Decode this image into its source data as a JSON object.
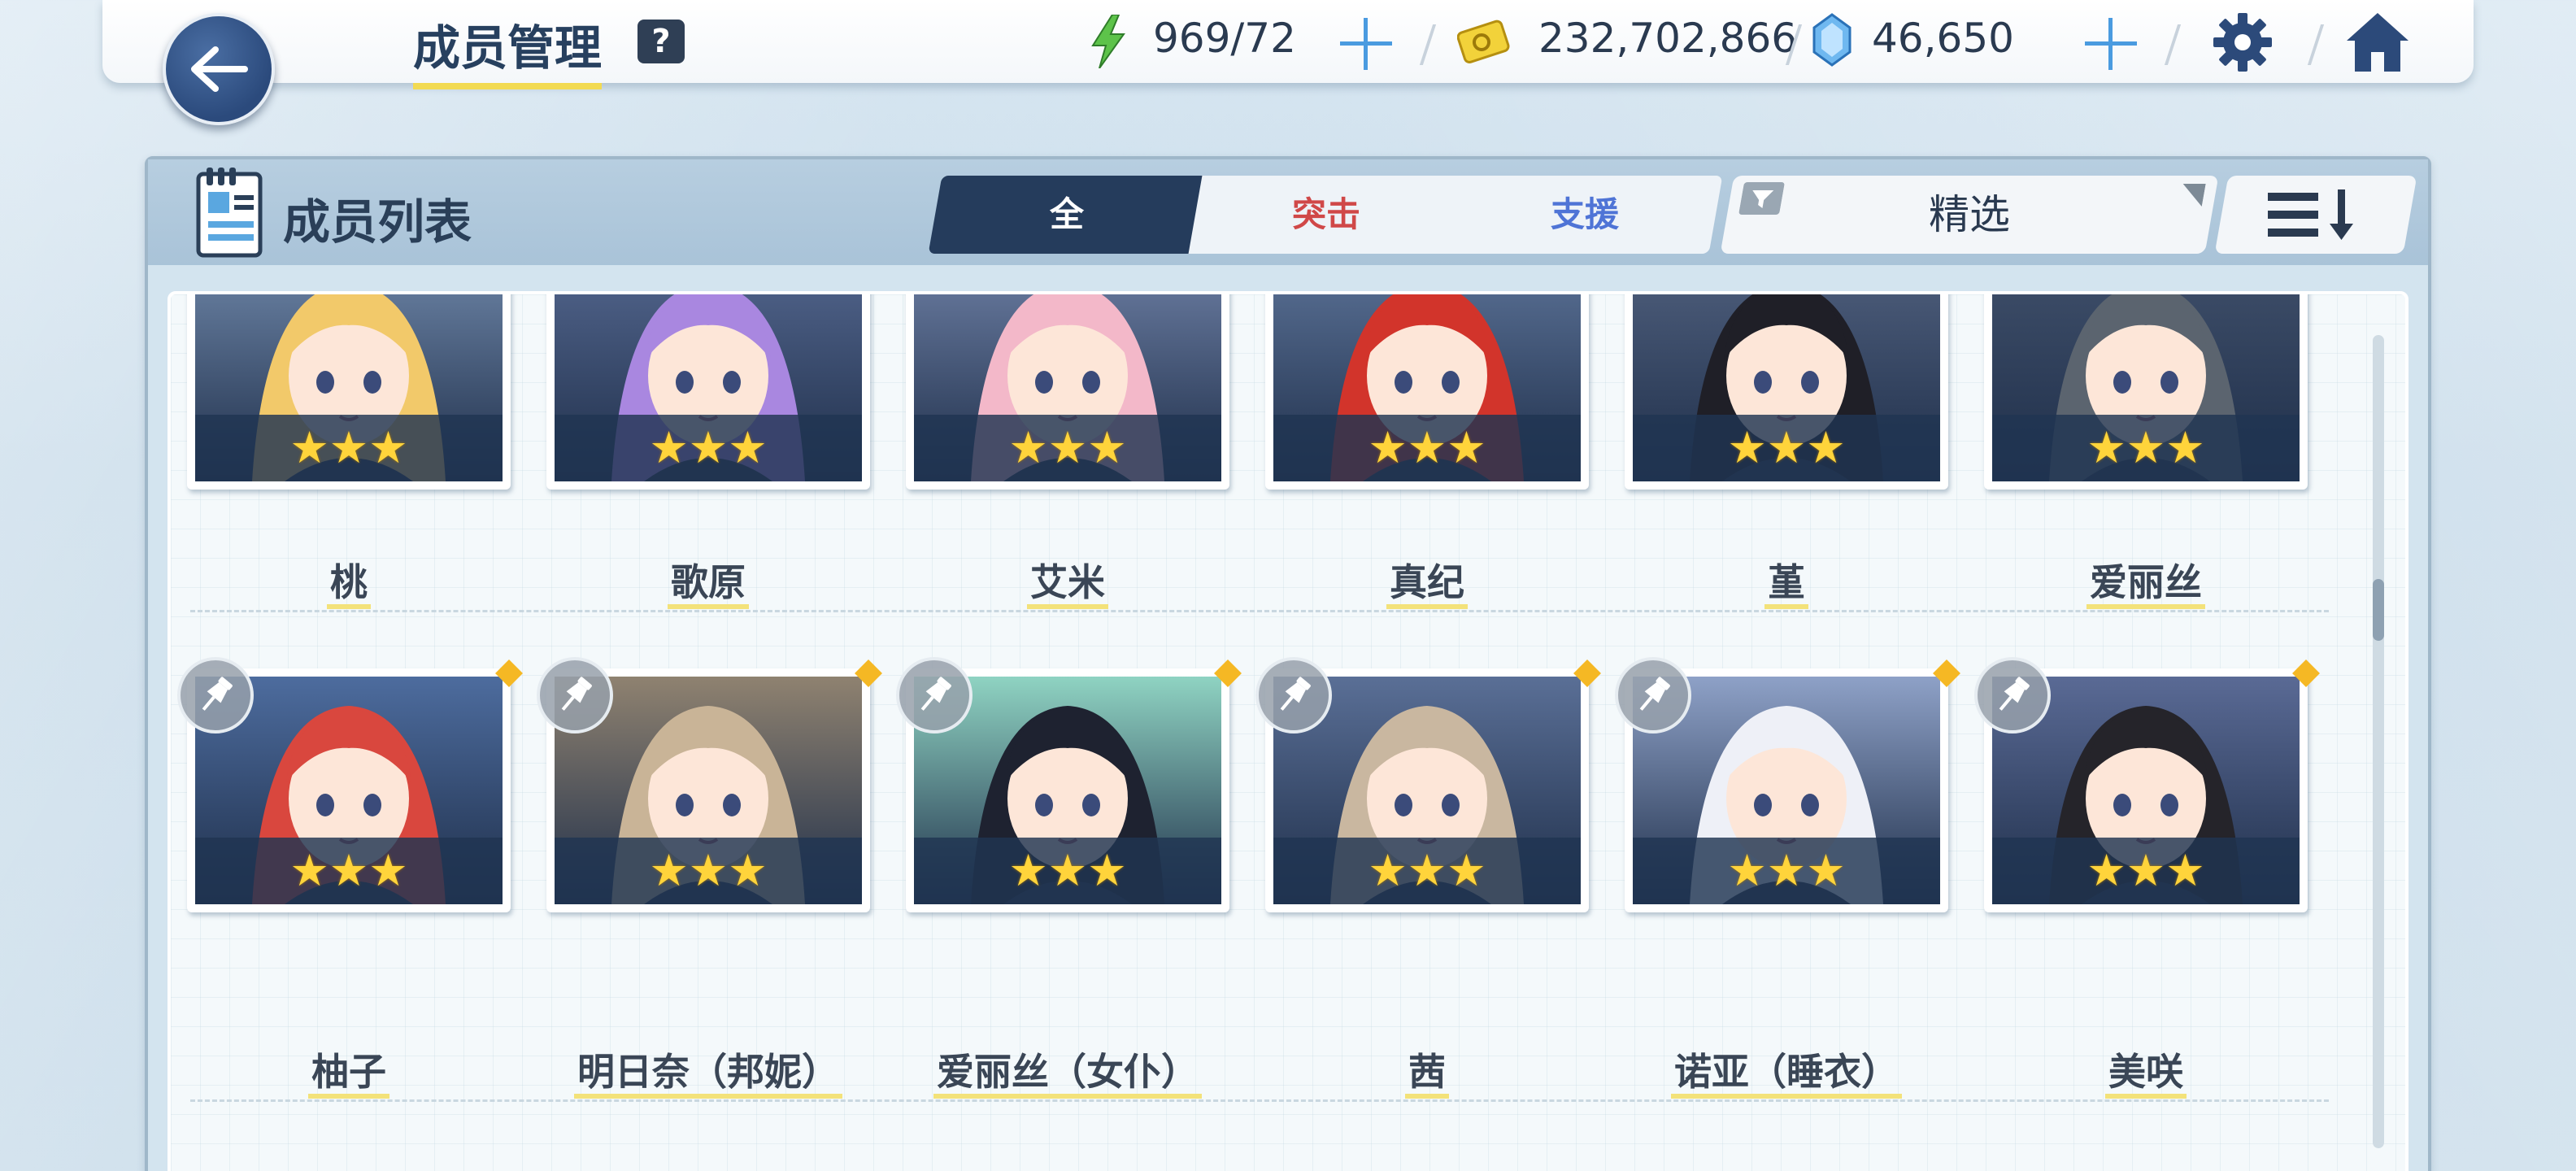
{
  "header": {
    "title": "成员管理",
    "help_label": "?",
    "ap_value": "969/72",
    "credits_value": "232,702,866",
    "pyroxene_value": "46,650"
  },
  "panel": {
    "title": "成员列表",
    "tabs": [
      {
        "label": "全",
        "active": true
      },
      {
        "label": "突击",
        "active": false
      },
      {
        "label": "支援",
        "active": false
      }
    ],
    "filter_label": "精选"
  },
  "characters": [
    {
      "name": "桃",
      "stars": "★★★",
      "hair": "#f2c96a",
      "bg": "#6e86a8",
      "pinned": false
    },
    {
      "name": "歌原",
      "stars": "★★★",
      "hair": "#a987e0",
      "bg": "#54678f",
      "pinned": false
    },
    {
      "name": "艾米",
      "stars": "★★★",
      "hair": "#f3b8c9",
      "bg": "#6d7fa4",
      "pinned": false
    },
    {
      "name": "真纪",
      "stars": "★★★",
      "hair": "#d2342b",
      "bg": "#5c7398",
      "pinned": false
    },
    {
      "name": "堇",
      "stars": "★★★",
      "hair": "#1f1f27",
      "bg": "#50607e",
      "pinned": false
    },
    {
      "name": "爱丽丝",
      "stars": "★★★",
      "hair": "#5b646f",
      "bg": "#40506b",
      "pinned": false
    },
    {
      "name": "柚子",
      "stars": "★★★",
      "hair": "#d9473e",
      "bg": "#4d6c9e",
      "pinned": true
    },
    {
      "name": "明日奈（邦妮）",
      "stars": "★★★",
      "hair": "#c9b497",
      "bg": "#8f8270",
      "pinned": true
    },
    {
      "name": "爱丽丝（女仆）",
      "stars": "★★★",
      "hair": "#1e2230",
      "bg": "#8fd3c2",
      "pinned": true
    },
    {
      "name": "茜",
      "stars": "★★★",
      "hair": "#c9b7a0",
      "bg": "#5a6f96",
      "pinned": true
    },
    {
      "name": "诺亚（睡衣）",
      "stars": "★★★",
      "hair": "#eef0f7",
      "bg": "#8ea1c7",
      "pinned": true
    },
    {
      "name": "美咲",
      "stars": "★★★",
      "hair": "#25242a",
      "bg": "#5a6a95",
      "pinned": true
    }
  ]
}
